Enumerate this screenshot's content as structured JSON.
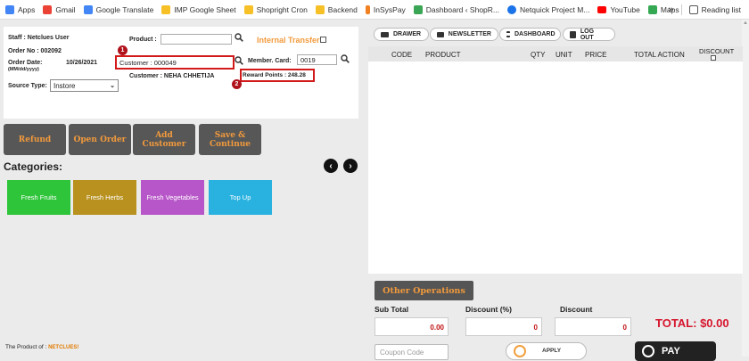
{
  "bookmarks": [
    {
      "label": "Apps",
      "color": "#4285f4"
    },
    {
      "label": "Gmail",
      "color": "#ea4335"
    },
    {
      "label": "Google Translate",
      "color": "#4285f4"
    },
    {
      "label": "IMP Google Sheet",
      "color": "#f6c026"
    },
    {
      "label": "Shopright Cron",
      "color": "#f6c026"
    },
    {
      "label": "Backend",
      "color": "#f6c026"
    },
    {
      "label": "InSysPay",
      "color": "#f08020"
    },
    {
      "label": "Dashboard ‹ ShopR...",
      "color": "#3aa655"
    },
    {
      "label": "Netquick Project M...",
      "color": "#1a73e8"
    },
    {
      "label": "YouTube",
      "color": "#ff0000"
    },
    {
      "label": "Maps",
      "color": "#34a853"
    }
  ],
  "bookmarks_overflow": "»",
  "reading_list": "Reading list",
  "order": {
    "staff": "Staff : Netclues User",
    "order_no": "Order No : 002092",
    "order_date_label": "Order Date:",
    "order_date_value": "10/26/2021",
    "order_date_format": "(MM/dd/yyyy)",
    "source_type_label": "Source Type:",
    "source_type_value": "Instore",
    "product_label": "Product :",
    "product_value": "",
    "internal_transfer_label": "Internal Transfer",
    "customer_value": "Customer : 000049",
    "customer_name": "Customer : NEHA CHHETIJA",
    "member_card_label": "Member. Card:",
    "member_card_value": "0019",
    "reward_points": "Reward Points : 248.28",
    "badge1": "1",
    "badge2": "2"
  },
  "actions": {
    "refund": "Refund",
    "open_order": "Open Order",
    "add_customer": "Add Customer",
    "save_continue": "Save & Continue"
  },
  "categories_title": "Categories:",
  "categories": [
    {
      "label": "Fresh Fruits",
      "color": "#2fc53a"
    },
    {
      "label": "Fresh Herbs",
      "color": "#b8911f"
    },
    {
      "label": "Fresh Vegetables",
      "color": "#b756c8"
    },
    {
      "label": "Top Up",
      "color": "#29b2e0"
    }
  ],
  "footer_text": "The Product of :",
  "footer_brand": "NETCLUES!",
  "tabs": [
    "DRAWER",
    "NEWSLETTER",
    "DASHBOARD",
    "LOG OUT"
  ],
  "grid_headers": [
    "CODE",
    "PRODUCT",
    "QTY",
    "UNIT",
    "PRICE",
    "TOTAL ACTION",
    "DISCOUNT"
  ],
  "other_operations": "Other Operations",
  "summary": {
    "sub_total_label": "Sub Total",
    "sub_total_value": "0.00",
    "discount_pct_label": "Discount (%)",
    "discount_pct_value": "0",
    "discount_label": "Discount",
    "discount_value": "0",
    "total": "TOTAL: $0.00"
  },
  "coupon_placeholder": "Coupon Code",
  "apply_label": "APPLY",
  "pay_label": "PAY"
}
